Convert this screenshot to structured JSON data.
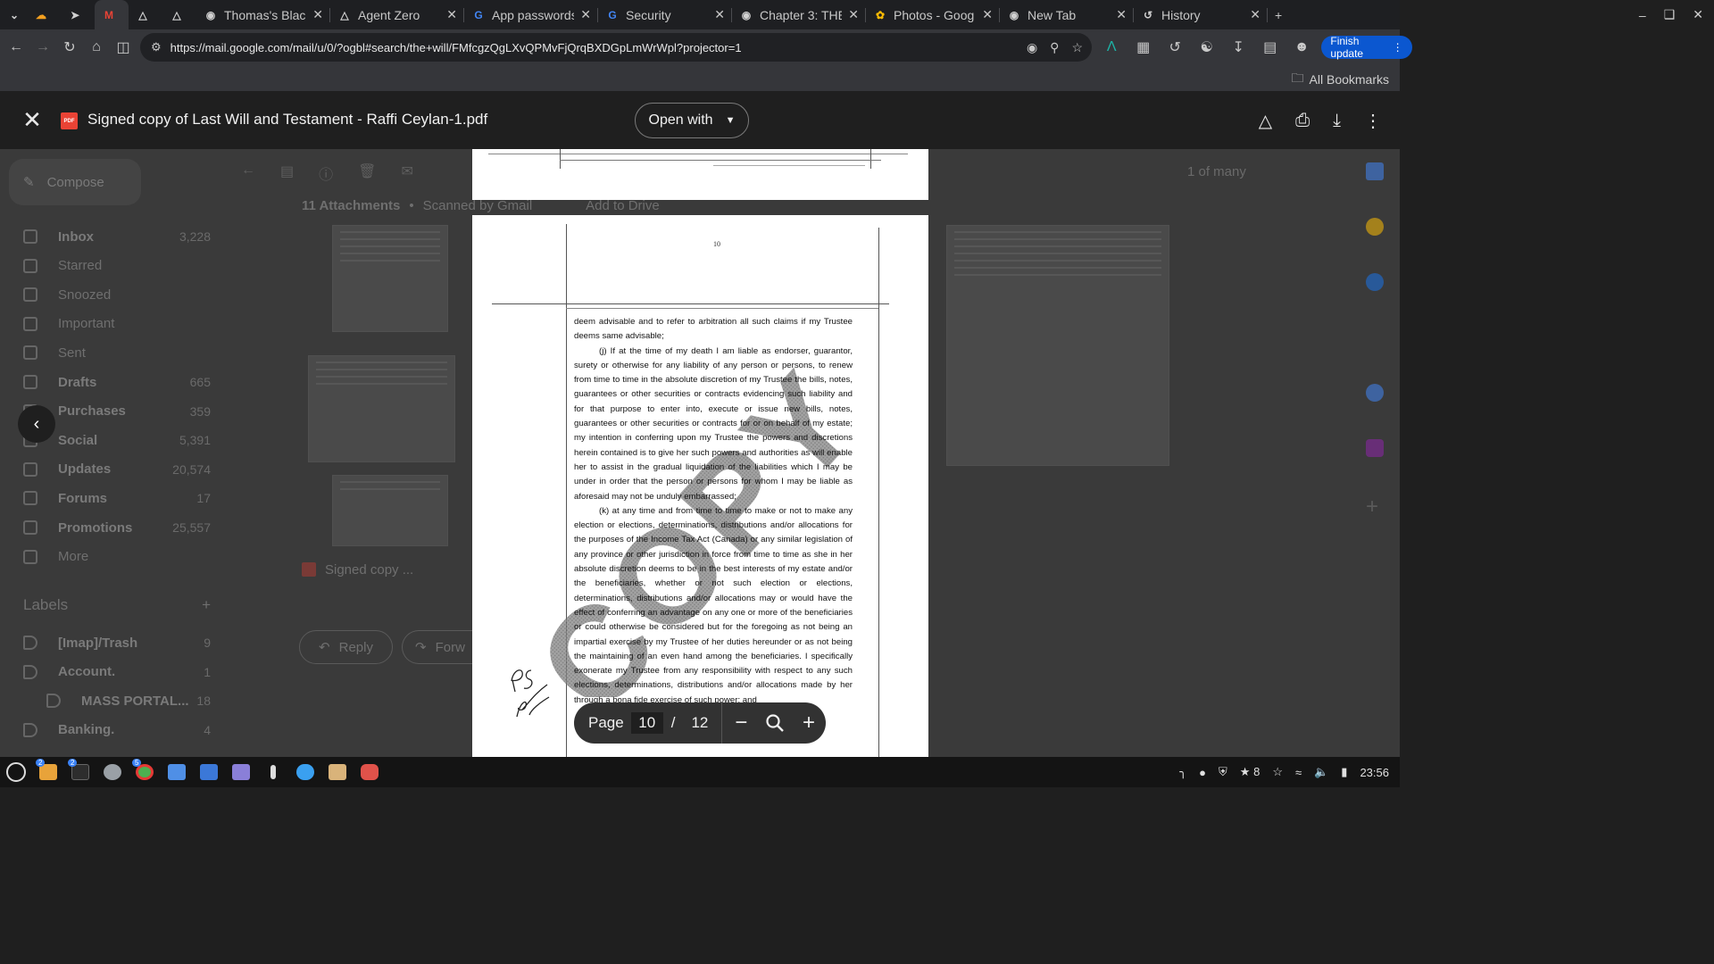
{
  "browser": {
    "tabs": [
      {
        "title": "",
        "icon": "chevron-down-icon"
      },
      {
        "title": "",
        "icon": "cloud-icon"
      },
      {
        "title": "",
        "icon": "share-icon"
      },
      {
        "title": "",
        "icon": "gmail-icon"
      },
      {
        "title": "",
        "icon": "warning-triangle-icon"
      },
      {
        "title": "",
        "icon": "warning-triangle-icon"
      },
      {
        "title": "Thomas's Blac",
        "icon": "web-icon"
      },
      {
        "title": "Agent Zero",
        "icon": "warning-triangle-icon"
      },
      {
        "title": "App passwords",
        "icon": "google-icon"
      },
      {
        "title": "Security",
        "icon": "google-icon"
      },
      {
        "title": "Chapter 3: THE",
        "icon": "web-icon"
      },
      {
        "title": "Photos - Goog",
        "icon": "photos-icon"
      },
      {
        "title": "New Tab",
        "icon": "chrome-icon"
      },
      {
        "title": "History",
        "icon": "history-icon"
      }
    ],
    "new_tab_label": "+",
    "url": "https://mail.google.com/mail/u/0/?ogbl#search/the+will/FMfcgzQgLXvQPMvFjQrqBXDGpLmWrWpl?projector=1",
    "finish_update_label": "Finish update",
    "all_bookmarks_label": "All Bookmarks"
  },
  "gmail": {
    "compose_label": "Compose",
    "nav": [
      {
        "label": "Inbox",
        "count": "3,228",
        "bold": true
      },
      {
        "label": "Starred",
        "count": "",
        "bold": false
      },
      {
        "label": "Snoozed",
        "count": "",
        "bold": false
      },
      {
        "label": "Important",
        "count": "",
        "bold": false
      },
      {
        "label": "Sent",
        "count": "",
        "bold": false
      },
      {
        "label": "Drafts",
        "count": "665",
        "bold": true
      },
      {
        "label": "Purchases",
        "count": "359",
        "bold": true
      },
      {
        "label": "Social",
        "count": "5,391",
        "bold": true
      },
      {
        "label": "Updates",
        "count": "20,574",
        "bold": true
      },
      {
        "label": "Forums",
        "count": "17",
        "bold": true
      },
      {
        "label": "Promotions",
        "count": "25,557",
        "bold": true
      },
      {
        "label": "More",
        "count": "",
        "bold": false
      }
    ],
    "labels_heading": "Labels",
    "labels": [
      {
        "label": "[Imap]/Trash",
        "count": "9"
      },
      {
        "label": "Account.",
        "count": "1"
      },
      {
        "label": "MASS PORTAL...",
        "count": "18"
      },
      {
        "label": "Banking.",
        "count": "4"
      }
    ],
    "attachments_heading": "11 Attachments",
    "scanned_label": "Scanned by Gmail",
    "add_to_drive_label": "Add to Drive",
    "pagination": "1 of many",
    "attachment_chip": "Signed copy ...",
    "reply_label": "Reply",
    "forward_label": "Forw"
  },
  "viewer": {
    "file_name": "Signed copy of Last Will and Testament - Raffi Ceylan-1.pdf",
    "pdf_badge": "PDF",
    "open_with_label": "Open with",
    "page_label": "Page",
    "current_page": "10",
    "separator": "/",
    "total_pages": "12",
    "document": {
      "page_number": "10",
      "paragraphs": [
        "deem advisable and to refer to arbitration all such claims if my Trustee deems same advisable;",
        "(j) If at the time of my death I am liable as endorser, guarantor, surety or otherwise for any liability of any person or persons, to renew from time to time in the absolute discretion of my Trustee the bills, notes, guarantees or other securities or contracts evidencing such liability and for that purpose to enter into, execute or issue new bills, notes, guarantees or other securities or contracts for or on behalf of my estate; my intention in conferring upon my Trustee the powers and discretions herein contained is to give her such powers and authorities as will enable her to assist in the gradual liquidation of the liabilities which I may be under in order that the person or persons for whom I may be liable as aforesaid may not be unduly embarrassed;",
        "(k) at any time and from time to time to make or not to make any election or elections, determinations, distributions and/or allocations for the purposes of the Income Tax Act (Canada) or any similar legislation of any province or other jurisdiction in force from time to time as she in her absolute discretion deems to be in the best interests of my estate and/or the beneficiaries, whether or not such election or elections, determinations, distributions and/or allocations may or would have the effect of conferring an advantage on any one or more of the beneficiaries or could otherwise be considered but for the foregoing as not being an impartial exercise by my Trustee of her duties hereunder or as not being the maintaining of an even hand among the beneficiaries. I specifically exonerate my Trustee from any responsibility with respect to any such elections, determinations, distributions and/or allocations made by her through a bona fide exercise of such power; and"
      ],
      "stamp_text": "COPY",
      "initials": [
        "PS",
        "RC"
      ]
    }
  },
  "taskbar": {
    "clock": "23:56",
    "tray_count": "8"
  }
}
